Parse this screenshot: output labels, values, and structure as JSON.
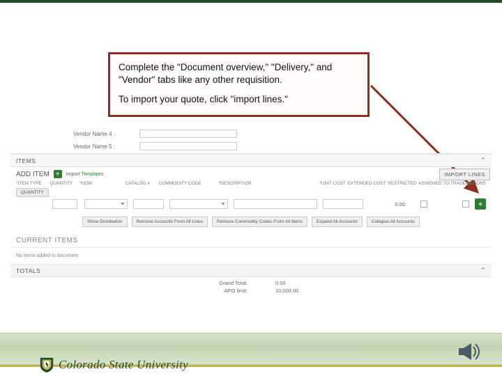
{
  "callout": {
    "p1": "Complete the \"Document overview,\" \"Delivery,\" and \"Vendor\" tabs like any other requisition.",
    "p2": "To import your quote,  click \"import lines.\""
  },
  "vendor_fields": {
    "name4_label": "Vendor Name 4 :",
    "name5_label": "Vendor Name 5 :"
  },
  "panels": {
    "items_title": "ITEMS",
    "add_item": "ADD ITEM",
    "import_template_link": "Import Templates",
    "import_lines_btn": "IMPORT LINES",
    "quantity_badge": "QUANTITY",
    "current_items_title": "CURRENT ITEMS",
    "no_items_text": "No items added to document",
    "totals_title": "TOTALS"
  },
  "columns": {
    "type": "*ITEM TYPE",
    "qty": "QUANTITY",
    "uom": "*UOM",
    "cat": "CATALOG #",
    "cc": "COMMODITY CODE",
    "desc": "*DESCRIPTION",
    "unit": "*UNIT COST",
    "ext": "EXTENDED COST",
    "res": "RESTRICTED",
    "ass": "ASSIGNED TO TRADE-IN",
    "act": "ACTIONS"
  },
  "row": {
    "ext_cost": "0.00"
  },
  "buttons": {
    "show_dist": "Show Distribution",
    "remove_accts": "Remove Accounts From All Lines",
    "remove_cc": "Remove Commodity Codes From All Items",
    "expand": "Expand All Accounts",
    "collapse": "Collapse All Accounts"
  },
  "totals": {
    "grand_label": "Grand Total:",
    "grand_value": "0.00",
    "apo_label": "APO limit:",
    "apo_value": "10,000.00"
  },
  "branding": {
    "wordmark": "Colorado State University"
  }
}
